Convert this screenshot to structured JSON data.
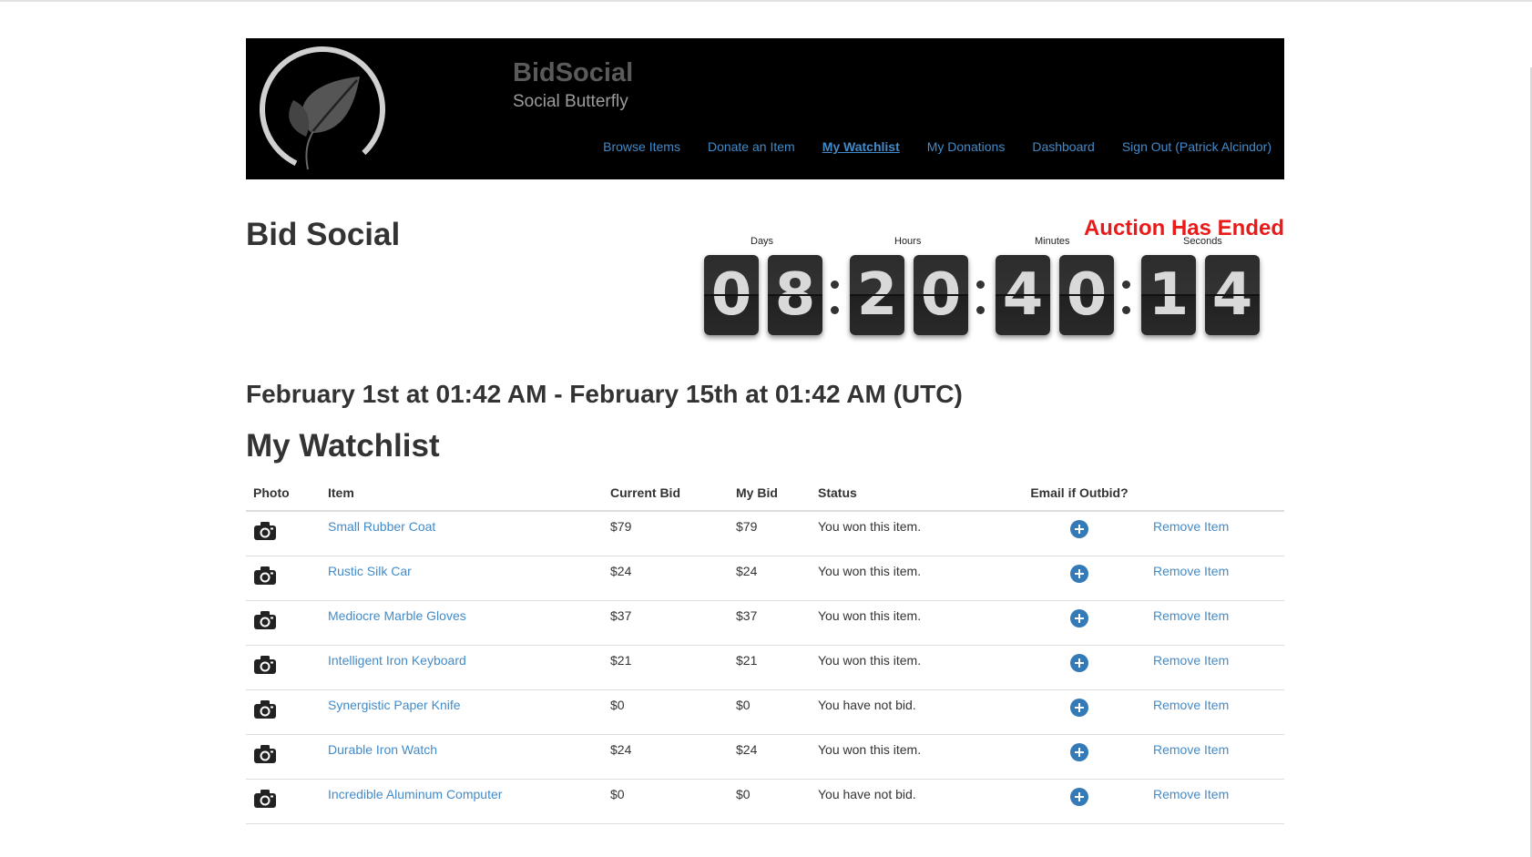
{
  "header": {
    "brand_title": "BidSocial",
    "brand_subtitle": "Social Butterfly",
    "nav": [
      {
        "label": "Browse Items",
        "active": false
      },
      {
        "label": "Donate an Item",
        "active": false
      },
      {
        "label": "My Watchlist",
        "active": true
      },
      {
        "label": "My Donations",
        "active": false
      },
      {
        "label": "Dashboard",
        "active": false
      },
      {
        "label": "Sign Out (Patrick Alcindor)",
        "active": false
      }
    ]
  },
  "page": {
    "title": "Bid Social",
    "auction_status": "Auction Has Ended",
    "date_range": "February 1st at 01:42 AM - February 15th at 01:42 AM (UTC)",
    "section_title": "My Watchlist"
  },
  "countdown": {
    "labels": {
      "days": "Days",
      "hours": "Hours",
      "minutes": "Minutes",
      "seconds": "Seconds"
    },
    "days": [
      "0",
      "8"
    ],
    "hours": [
      "2",
      "0"
    ],
    "minutes": [
      "4",
      "0"
    ],
    "seconds": [
      "1",
      "4"
    ]
  },
  "table": {
    "headers": {
      "photo": "Photo",
      "item": "Item",
      "current_bid": "Current Bid",
      "my_bid": "My Bid",
      "status": "Status",
      "email": "Email if Outbid?"
    },
    "remove_label": "Remove Item",
    "rows": [
      {
        "item": "Small Rubber Coat",
        "current_bid": "$79",
        "my_bid": "$79",
        "status": "You won this item."
      },
      {
        "item": "Rustic Silk Car",
        "current_bid": "$24",
        "my_bid": "$24",
        "status": "You won this item."
      },
      {
        "item": "Mediocre Marble Gloves",
        "current_bid": "$37",
        "my_bid": "$37",
        "status": "You won this item."
      },
      {
        "item": "Intelligent Iron Keyboard",
        "current_bid": "$21",
        "my_bid": "$21",
        "status": "You won this item."
      },
      {
        "item": "Synergistic Paper Knife",
        "current_bid": "$0",
        "my_bid": "$0",
        "status": "You have not bid."
      },
      {
        "item": "Durable Iron Watch",
        "current_bid": "$24",
        "my_bid": "$24",
        "status": "You won this item."
      },
      {
        "item": "Incredible Aluminum Computer",
        "current_bid": "$0",
        "my_bid": "$0",
        "status": "You have not bid."
      }
    ]
  },
  "colors": {
    "link": "#428bca",
    "alert_red": "#e81a1a",
    "header_bg": "#000000",
    "plus_icon": "#337ab7"
  },
  "icons": {
    "photo": "camera-icon",
    "email_toggle": "plus-circle-icon",
    "logo": "leaf-logo"
  }
}
